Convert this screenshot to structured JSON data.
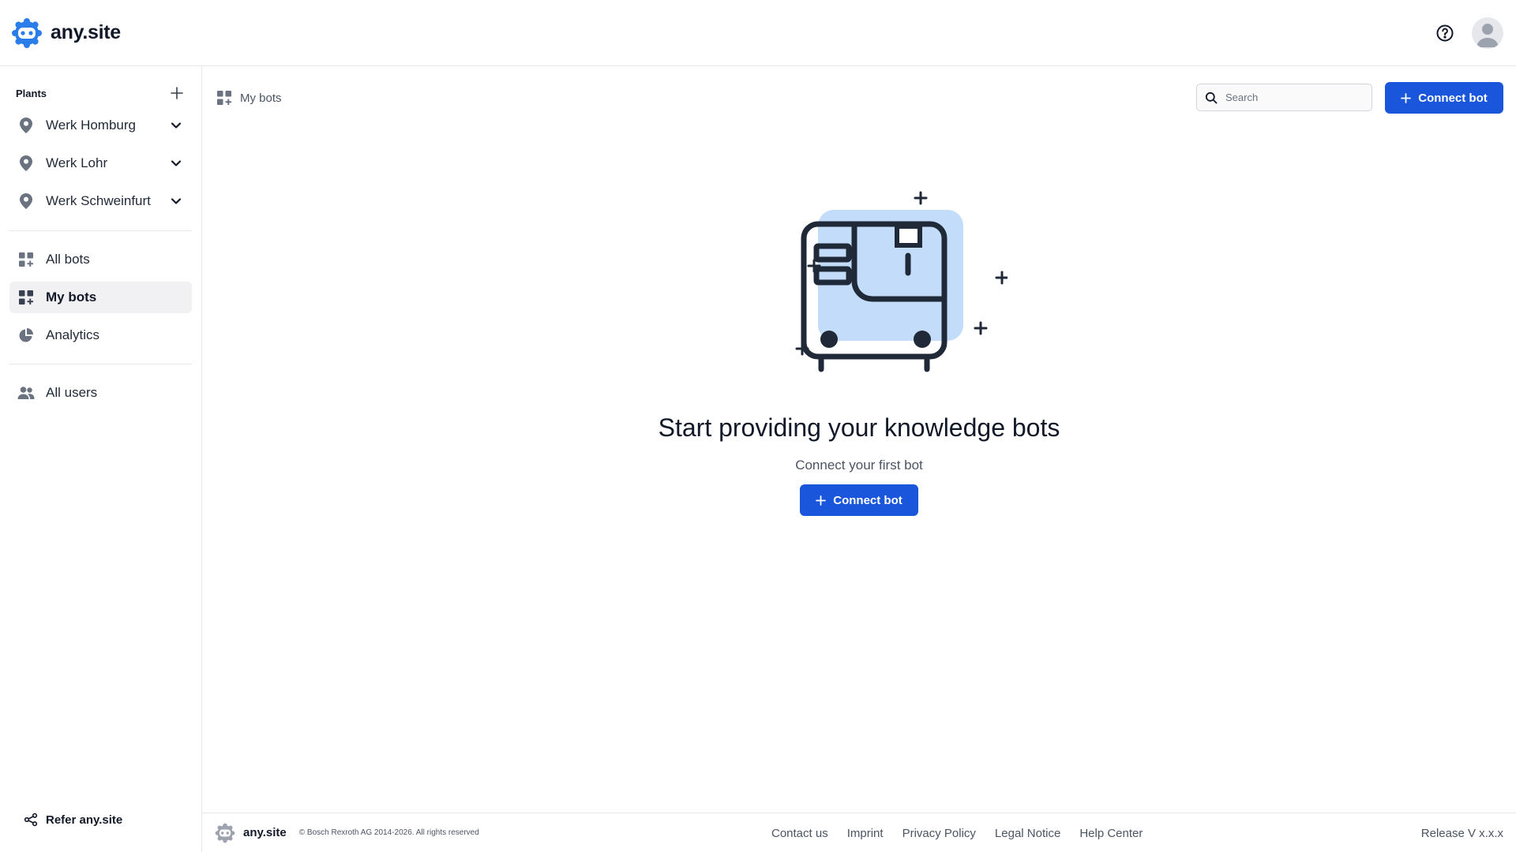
{
  "header": {
    "brand_name": "any.site",
    "help_icon": "help-circle-icon",
    "avatar_icon": "user-avatar-icon"
  },
  "sidebar": {
    "plants_title": "Plants",
    "plants": [
      {
        "label": "Werk Homburg",
        "icon": "map-pin-icon"
      },
      {
        "label": "Werk Lohr",
        "icon": "map-pin-icon"
      },
      {
        "label": "Werk Schweinfurt",
        "icon": "map-pin-icon"
      }
    ],
    "nav": [
      {
        "label": "All bots",
        "icon": "apps-grid-icon",
        "active": false
      },
      {
        "label": "My bots",
        "icon": "apps-grid-add-icon",
        "active": true
      },
      {
        "label": "Analytics",
        "icon": "pie-chart-icon",
        "active": false
      }
    ],
    "users": {
      "label": "All users",
      "icon": "users-icon"
    },
    "refer_label": "Refer any.site"
  },
  "main": {
    "breadcrumb": "My bots",
    "search_placeholder": "Search",
    "connect_label": "Connect bot",
    "empty_title": "Start providing your knowledge bots",
    "empty_subtitle": "Connect your first bot",
    "empty_button_label": "Connect bot"
  },
  "footer": {
    "brand_name": "any.site",
    "copyright": "© Bosch Rexroth AG 2014-2026. All rights reserved",
    "links": [
      "Contact us",
      "Imprint",
      "Privacy Policy",
      "Legal Notice",
      "Help Center"
    ],
    "release": "Release V x.x.x"
  },
  "colors": {
    "primary": "#1a56db",
    "illustration_fill": "#c3dcfa",
    "illustration_stroke": "#1f2937",
    "active_bg": "#f1f1f3"
  }
}
